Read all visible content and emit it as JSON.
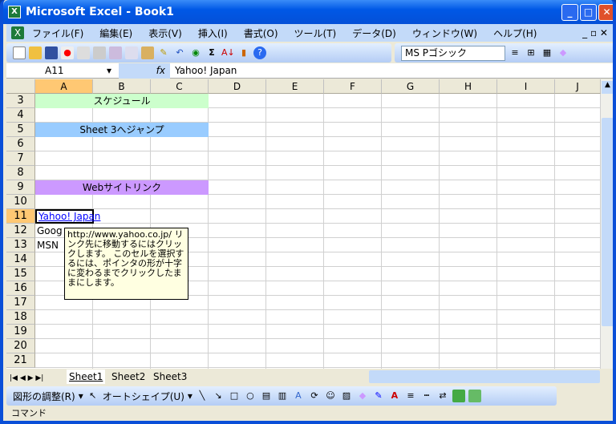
{
  "window": {
    "title": "Microsoft Excel - Book1"
  },
  "menu": [
    "ファイル(F)",
    "編集(E)",
    "表示(V)",
    "挿入(I)",
    "書式(O)",
    "ツール(T)",
    "データ(D)",
    "ウィンドウ(W)",
    "ヘルプ(H)"
  ],
  "toolbar": {
    "font": "MS Pゴシック"
  },
  "formula_bar": {
    "name_box": "A11",
    "fx": "fx",
    "value": "Yahoo! Japan"
  },
  "columns": [
    "A",
    "B",
    "C",
    "D",
    "E",
    "F",
    "G",
    "H",
    "I",
    "J"
  ],
  "rows": [
    "3",
    "4",
    "5",
    "6",
    "7",
    "8",
    "9",
    "10",
    "11",
    "12",
    "13",
    "14",
    "15",
    "16",
    "17",
    "18",
    "19",
    "20",
    "21"
  ],
  "cells": {
    "schedule": "スケジュール",
    "jump": "Sheet 3へジャンプ",
    "web": "Webサイトリンク",
    "yahoo": "Yahoo! Japan",
    "google": "Goog",
    "msn": "MSN"
  },
  "colors": {
    "schedule": "#ccffcc",
    "jump": "#99ccff",
    "web": "#cc99ff",
    "link": "#0000ff"
  },
  "tooltip": "http://www.yahoo.co.jp/ リンク先に移動するにはクリックします。 このセルを選択するには、ポインタの形が十字に変わるまでクリックしたままにします。",
  "sheets": [
    "Sheet1",
    "Sheet2",
    "Sheet3"
  ],
  "drawing": {
    "adjust": "図形の調整(R)",
    "autoshape": "オートシェイプ(U)"
  },
  "status": "コマンド"
}
